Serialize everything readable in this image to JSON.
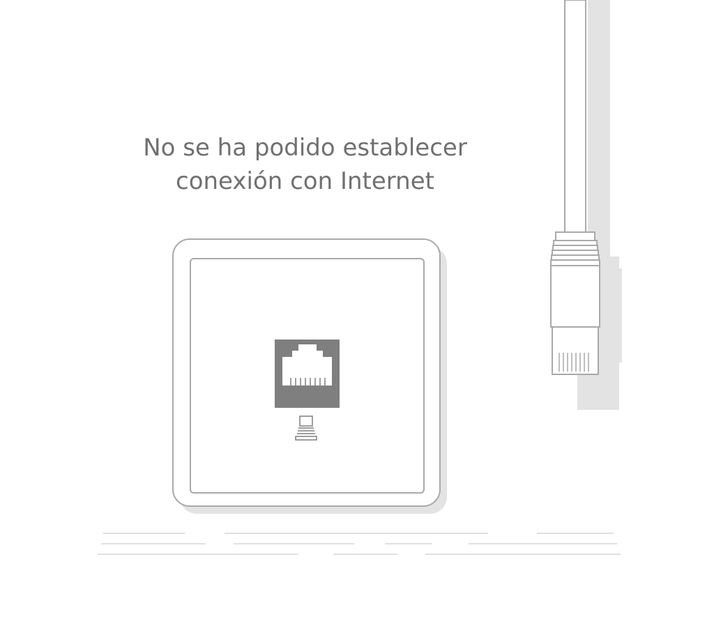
{
  "error_page": {
    "message_line1": "No se ha podido establecer",
    "message_line2": "conexión con Internet"
  },
  "illustration": {
    "wall_socket_icon": "ethernet-wall-socket-icon",
    "cable_icon": "ethernet-cable-plug-icon",
    "colors": {
      "stroke": "#a9a9a9",
      "port_fill": "#7f7f7f",
      "shadow": "#e3e3e3",
      "text": "#707070"
    }
  }
}
